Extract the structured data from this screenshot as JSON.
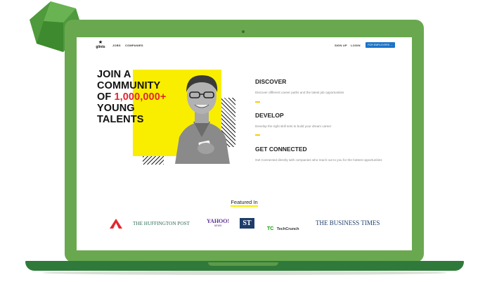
{
  "nav": {
    "logo": "glints",
    "links": [
      "JOBS",
      "COMPANIES"
    ],
    "signup": "SIGN UP",
    "login": "LOGIN",
    "employers": "FOR EMPLOYERS →"
  },
  "hero": {
    "line1": "JOIN A",
    "line2": "COMMUNITY",
    "line3_prefix": "OF ",
    "line3_highlight": "1,000,000+",
    "line4": "YOUNG",
    "line5": "TALENTS"
  },
  "sections": [
    {
      "title": "DISCOVER",
      "text": "Discover different career paths and the latest job opportunities"
    },
    {
      "title": "DEVELOP",
      "text": "Develop the right skill sets to build your dream career"
    },
    {
      "title": "GET CONNECTED",
      "text": "Get Connected directly with companies who reach out to you for the hottest opportunities"
    }
  ],
  "featured": {
    "heading": "Featured In",
    "logos": {
      "huffington": "THE HUFFINGTON POST",
      "yahoo": "YAHOO!",
      "yahoo_sub": "NEWS",
      "st": "ST",
      "tc_mark": "TC",
      "techcrunch": "TechCrunch",
      "business_times": "THE BUSINESS TIMES"
    }
  },
  "colors": {
    "laptop_green": "#6aa84f",
    "accent_yellow": "#f9ee00",
    "highlight_red": "#e3262f",
    "button_blue": "#1a73c8"
  }
}
